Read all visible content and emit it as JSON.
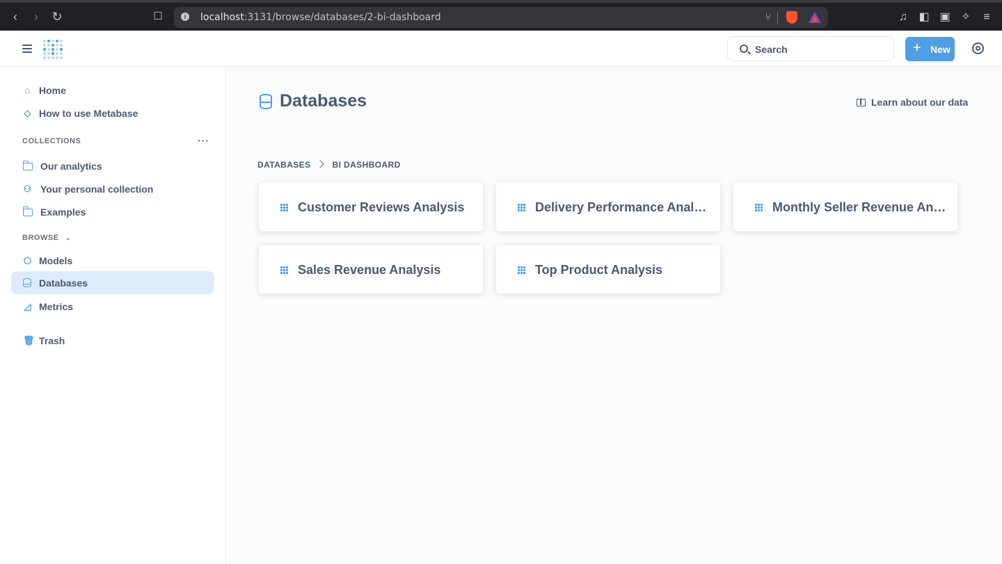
{
  "browser": {
    "url_host": "localhost",
    "url_rest": ":3131/browse/databases/2-bi-dashboard"
  },
  "header": {
    "search_label": "Search",
    "new_label": "New"
  },
  "sidebar": {
    "top_items": [
      {
        "label": "Home",
        "icon": "home-icon"
      },
      {
        "label": "How to use Metabase",
        "icon": "graduation-cap-icon"
      }
    ],
    "collections_heading": "COLLECTIONS",
    "collections": [
      {
        "label": "Our analytics",
        "icon": "folder-icon"
      },
      {
        "label": "Your personal collection",
        "icon": "person-icon"
      },
      {
        "label": "Examples",
        "icon": "folder-icon"
      }
    ],
    "browse_heading": "BROWSE",
    "browse_items": [
      {
        "label": "Models",
        "icon": "cube-icon"
      },
      {
        "label": "Databases",
        "icon": "database-icon",
        "active": true
      },
      {
        "label": "Metrics",
        "icon": "metric-icon"
      }
    ],
    "trash_label": "Trash"
  },
  "main": {
    "title": "Databases",
    "learn_link": "Learn about our data",
    "breadcrumb": [
      "DATABASES",
      "BI DASHBOARD"
    ],
    "tables": [
      "Customer Reviews Analysis",
      "Delivery Performance Anal…",
      "Monthly Seller Revenue An…",
      "Sales Revenue Analysis",
      "Top Product Analysis"
    ]
  },
  "colors": {
    "accent": "#509ee3",
    "text": "#4c5773",
    "active_bg": "#ddecfa"
  }
}
